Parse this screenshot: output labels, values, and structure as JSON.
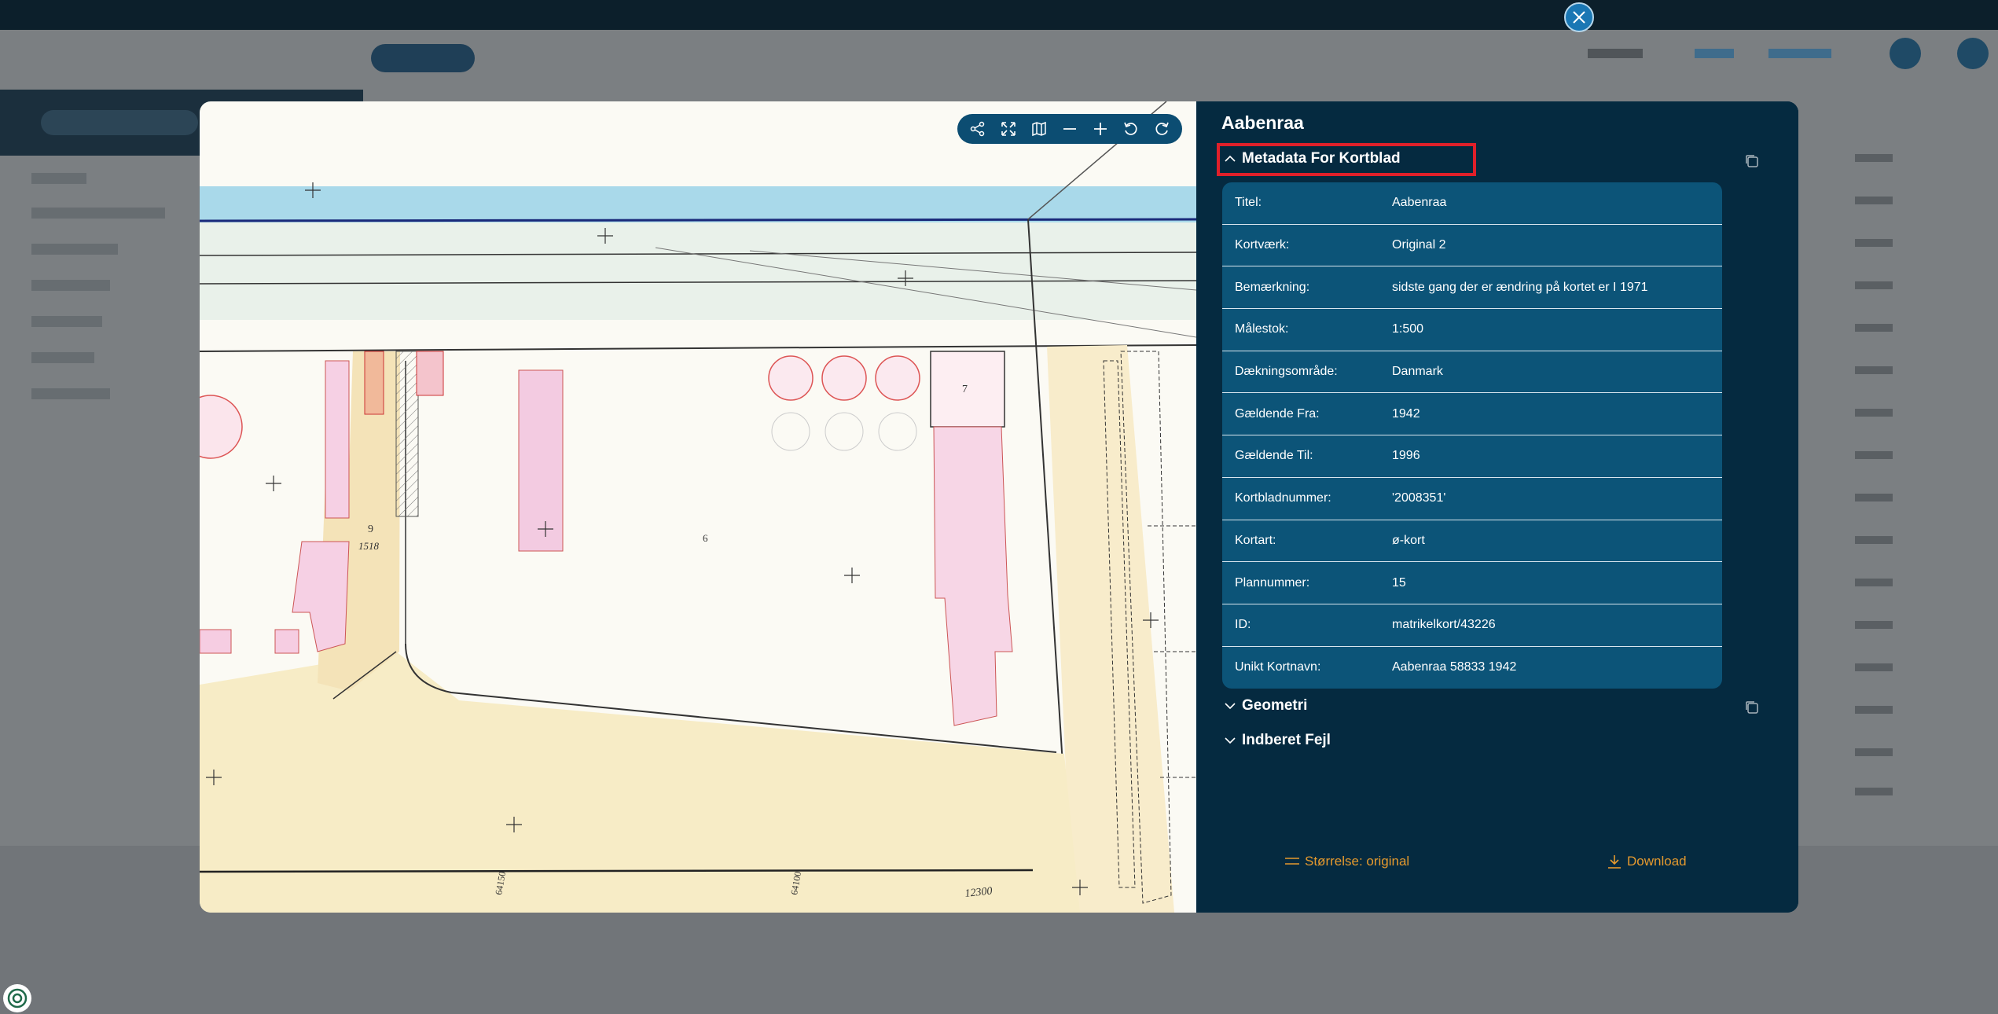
{
  "modal": {
    "title": "Aabenraa",
    "sections": {
      "metadata": "Metadata For Kortblad",
      "geometry": "Geometri",
      "errors": "Indberet Fejl"
    },
    "metadata_rows": [
      {
        "key": "Titel:",
        "value": "Aabenraa"
      },
      {
        "key": "Kortværk:",
        "value": "Original 2"
      },
      {
        "key": "Bemærkning:",
        "value": "sidste gang der er ændring på kortet er I 1971"
      },
      {
        "key": "Målestok:",
        "value": "1:500"
      },
      {
        "key": "Dækningsområde:",
        "value": "Danmark"
      },
      {
        "key": "Gældende Fra:",
        "value": "1942"
      },
      {
        "key": "Gældende Til:",
        "value": "1996"
      },
      {
        "key": "Kortbladnummer:",
        "value": "'2008351'"
      },
      {
        "key": "Kortart:",
        "value": "ø-kort"
      },
      {
        "key": "Plannummer:",
        "value": "15"
      },
      {
        "key": "ID:",
        "value": "matrikelkort/43226"
      },
      {
        "key": "Unikt Kortnavn:",
        "value": "Aabenraa 58833 1942"
      }
    ],
    "footer": {
      "size_label": "Størrelse: original",
      "download_label": "Download"
    }
  },
  "toolbar_icons": [
    "share-icon",
    "fullscreen-icon",
    "map-icon",
    "zoom-out-icon",
    "zoom-in-icon",
    "rotate-left-icon",
    "rotate-right-icon"
  ],
  "map_labels": {
    "parcel_a": "9",
    "parcel_b": "1518",
    "parcel_c": "6",
    "number_a": "12300",
    "number_b": "64100",
    "number_c": "64150",
    "plot_7": "7"
  },
  "colors": {
    "panel_bg": "#052a40",
    "table_bg": "#0c5478",
    "accent_orange": "#e69a2e",
    "highlight_red": "#e0202a",
    "close_button": "#1a77b4"
  }
}
